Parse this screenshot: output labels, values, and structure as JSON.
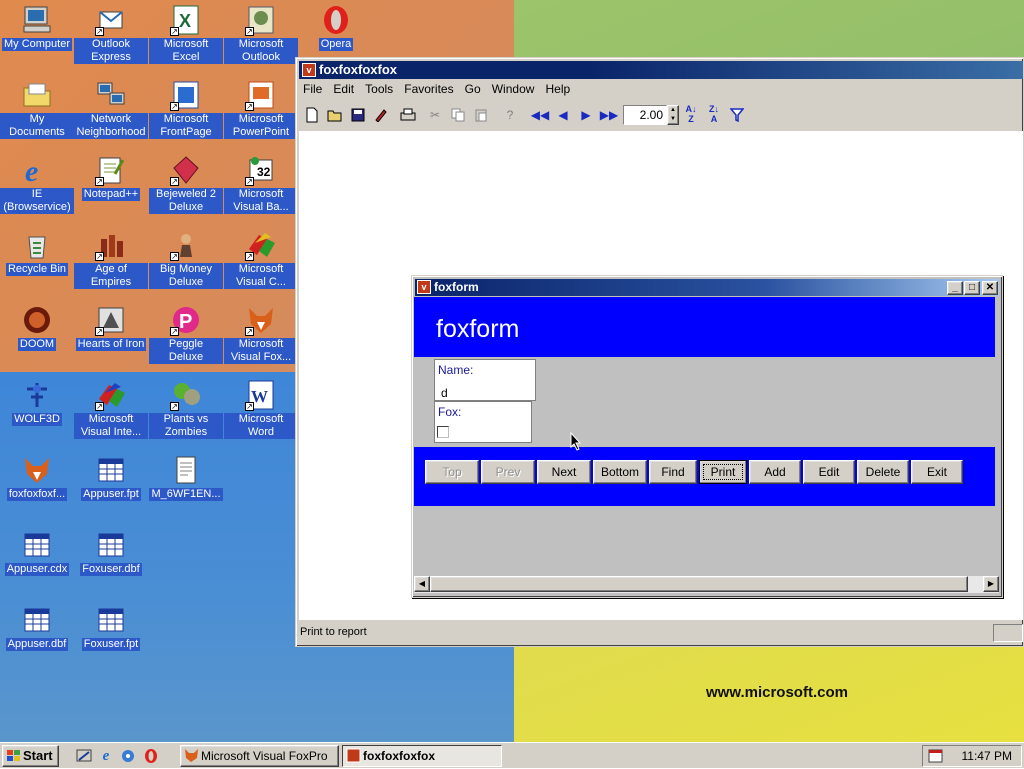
{
  "desktop": {
    "icons": [
      {
        "label": "My Computer",
        "icon": "my-computer-icon"
      },
      {
        "label": "Outlook Express",
        "icon": "outlook-express-icon"
      },
      {
        "label": "Microsoft Excel",
        "icon": "excel-icon"
      },
      {
        "label": "Microsoft Outlook",
        "icon": "outlook-icon"
      },
      {
        "label": "Opera",
        "icon": "opera-icon"
      },
      {
        "label": "My Documents",
        "icon": "folder-icon"
      },
      {
        "label": "Network Neighborhood",
        "icon": "network-icon"
      },
      {
        "label": "Microsoft FrontPage",
        "icon": "frontpage-icon"
      },
      {
        "label": "Microsoft PowerPoint",
        "icon": "powerpoint-icon"
      },
      {
        "label": "IE (Browservice)",
        "icon": "internet-explorer-icon"
      },
      {
        "label": "Notepad++",
        "icon": "notepad-icon"
      },
      {
        "label": "Bejeweled 2 Deluxe",
        "icon": "bejeweled-icon"
      },
      {
        "label": "Microsoft Visual Ba...",
        "icon": "visual-basic-icon"
      },
      {
        "label": "Recycle Bin",
        "icon": "recycle-bin-icon"
      },
      {
        "label": "Age of Empires",
        "icon": "age-of-empires-icon"
      },
      {
        "label": "Big Money Deluxe",
        "icon": "big-money-icon"
      },
      {
        "label": "Microsoft Visual C...",
        "icon": "visual-c-icon"
      },
      {
        "label": "DOOM",
        "icon": "doom-icon"
      },
      {
        "label": "Hearts of Iron",
        "icon": "hearts-of-iron-icon"
      },
      {
        "label": "Peggle Deluxe",
        "icon": "peggle-icon"
      },
      {
        "label": "Microsoft Visual Fox...",
        "icon": "visual-foxpro-icon"
      },
      {
        "label": "WOLF3D",
        "icon": "wolf3d-icon"
      },
      {
        "label": "Microsoft Visual Inte...",
        "icon": "visual-interdev-icon"
      },
      {
        "label": "Plants vs Zombies",
        "icon": "plants-vs-zombies-icon"
      },
      {
        "label": "Microsoft Word",
        "icon": "word-icon"
      },
      {
        "label": "foxfoxfoxf...",
        "icon": "fox-icon"
      },
      {
        "label": "Appuser.fpt",
        "icon": "table-file-icon"
      },
      {
        "label": "M_6WF1EN...",
        "icon": "document-file-icon"
      },
      {
        "label": "Appuser.cdx",
        "icon": "table-file-icon"
      },
      {
        "label": "Foxuser.dbf",
        "icon": "table-file-icon"
      },
      {
        "label": "Appuser.dbf",
        "icon": "table-file-icon"
      },
      {
        "label": "Foxuser.fpt",
        "icon": "table-file-icon"
      }
    ],
    "wallpaper_text": "www.microsoft.com"
  },
  "main_window": {
    "title": "foxfoxfoxfox",
    "menu": [
      "File",
      "Edit",
      "Tools",
      "Favorites",
      "Go",
      "Window",
      "Help"
    ],
    "toolbar": {
      "zoom_value": "2.00",
      "buttons": [
        "new-icon",
        "open-icon",
        "save-icon",
        "edit-icon",
        "print-icon",
        "cut-icon",
        "copy-icon",
        "paste-icon",
        "help-icon",
        "first-record-icon",
        "previous-record-icon",
        "next-record-icon",
        "last-record-icon",
        "sort-ascending-icon",
        "sort-descending-icon",
        "filter-icon"
      ]
    },
    "status_text": "Print to report"
  },
  "form_window": {
    "title": "foxform",
    "heading": "foxform",
    "name_label": "Name:",
    "name_value": "d",
    "fox_label": "Fox:",
    "fox_checked": false,
    "buttons": [
      {
        "label": "Top",
        "enabled": false
      },
      {
        "label": "Prev",
        "enabled": false
      },
      {
        "label": "Next",
        "enabled": true
      },
      {
        "label": "Bottom",
        "enabled": true
      },
      {
        "label": "Find",
        "enabled": true
      },
      {
        "label": "Print",
        "enabled": true,
        "focused": true
      },
      {
        "label": "Add",
        "enabled": true
      },
      {
        "label": "Edit",
        "enabled": true
      },
      {
        "label": "Delete",
        "enabled": true
      },
      {
        "label": "Exit",
        "enabled": true
      }
    ],
    "colors": {
      "banner": "#0000ff",
      "title_active": "#0a246a"
    }
  },
  "taskbar": {
    "start_label": "Start",
    "quick_launch": [
      "show-desktop-icon",
      "internet-explorer-icon",
      "channels-icon",
      "opera-icon"
    ],
    "tasks": [
      {
        "label": "Microsoft Visual FoxPro",
        "active": false
      },
      {
        "label": "foxfoxfoxfox",
        "active": true
      }
    ],
    "clock": "11:47 PM"
  }
}
